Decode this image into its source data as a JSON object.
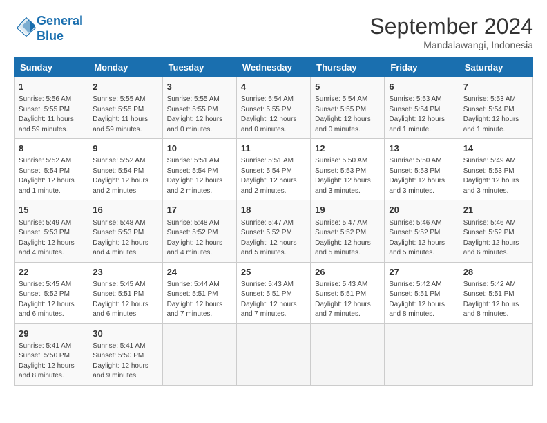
{
  "header": {
    "logo_line1": "General",
    "logo_line2": "Blue",
    "month": "September 2024",
    "location": "Mandalawangi, Indonesia"
  },
  "weekdays": [
    "Sunday",
    "Monday",
    "Tuesday",
    "Wednesday",
    "Thursday",
    "Friday",
    "Saturday"
  ],
  "weeks": [
    [
      {
        "day": "1",
        "info": "Sunrise: 5:56 AM\nSunset: 5:55 PM\nDaylight: 11 hours\nand 59 minutes."
      },
      {
        "day": "2",
        "info": "Sunrise: 5:55 AM\nSunset: 5:55 PM\nDaylight: 11 hours\nand 59 minutes."
      },
      {
        "day": "3",
        "info": "Sunrise: 5:55 AM\nSunset: 5:55 PM\nDaylight: 12 hours\nand 0 minutes."
      },
      {
        "day": "4",
        "info": "Sunrise: 5:54 AM\nSunset: 5:55 PM\nDaylight: 12 hours\nand 0 minutes."
      },
      {
        "day": "5",
        "info": "Sunrise: 5:54 AM\nSunset: 5:55 PM\nDaylight: 12 hours\nand 0 minutes."
      },
      {
        "day": "6",
        "info": "Sunrise: 5:53 AM\nSunset: 5:54 PM\nDaylight: 12 hours\nand 1 minute."
      },
      {
        "day": "7",
        "info": "Sunrise: 5:53 AM\nSunset: 5:54 PM\nDaylight: 12 hours\nand 1 minute."
      }
    ],
    [
      {
        "day": "8",
        "info": "Sunrise: 5:52 AM\nSunset: 5:54 PM\nDaylight: 12 hours\nand 1 minute."
      },
      {
        "day": "9",
        "info": "Sunrise: 5:52 AM\nSunset: 5:54 PM\nDaylight: 12 hours\nand 2 minutes."
      },
      {
        "day": "10",
        "info": "Sunrise: 5:51 AM\nSunset: 5:54 PM\nDaylight: 12 hours\nand 2 minutes."
      },
      {
        "day": "11",
        "info": "Sunrise: 5:51 AM\nSunset: 5:54 PM\nDaylight: 12 hours\nand 2 minutes."
      },
      {
        "day": "12",
        "info": "Sunrise: 5:50 AM\nSunset: 5:53 PM\nDaylight: 12 hours\nand 3 minutes."
      },
      {
        "day": "13",
        "info": "Sunrise: 5:50 AM\nSunset: 5:53 PM\nDaylight: 12 hours\nand 3 minutes."
      },
      {
        "day": "14",
        "info": "Sunrise: 5:49 AM\nSunset: 5:53 PM\nDaylight: 12 hours\nand 3 minutes."
      }
    ],
    [
      {
        "day": "15",
        "info": "Sunrise: 5:49 AM\nSunset: 5:53 PM\nDaylight: 12 hours\nand 4 minutes."
      },
      {
        "day": "16",
        "info": "Sunrise: 5:48 AM\nSunset: 5:53 PM\nDaylight: 12 hours\nand 4 minutes."
      },
      {
        "day": "17",
        "info": "Sunrise: 5:48 AM\nSunset: 5:52 PM\nDaylight: 12 hours\nand 4 minutes."
      },
      {
        "day": "18",
        "info": "Sunrise: 5:47 AM\nSunset: 5:52 PM\nDaylight: 12 hours\nand 5 minutes."
      },
      {
        "day": "19",
        "info": "Sunrise: 5:47 AM\nSunset: 5:52 PM\nDaylight: 12 hours\nand 5 minutes."
      },
      {
        "day": "20",
        "info": "Sunrise: 5:46 AM\nSunset: 5:52 PM\nDaylight: 12 hours\nand 5 minutes."
      },
      {
        "day": "21",
        "info": "Sunrise: 5:46 AM\nSunset: 5:52 PM\nDaylight: 12 hours\nand 6 minutes."
      }
    ],
    [
      {
        "day": "22",
        "info": "Sunrise: 5:45 AM\nSunset: 5:52 PM\nDaylight: 12 hours\nand 6 minutes."
      },
      {
        "day": "23",
        "info": "Sunrise: 5:45 AM\nSunset: 5:51 PM\nDaylight: 12 hours\nand 6 minutes."
      },
      {
        "day": "24",
        "info": "Sunrise: 5:44 AM\nSunset: 5:51 PM\nDaylight: 12 hours\nand 7 minutes."
      },
      {
        "day": "25",
        "info": "Sunrise: 5:43 AM\nSunset: 5:51 PM\nDaylight: 12 hours\nand 7 minutes."
      },
      {
        "day": "26",
        "info": "Sunrise: 5:43 AM\nSunset: 5:51 PM\nDaylight: 12 hours\nand 7 minutes."
      },
      {
        "day": "27",
        "info": "Sunrise: 5:42 AM\nSunset: 5:51 PM\nDaylight: 12 hours\nand 8 minutes."
      },
      {
        "day": "28",
        "info": "Sunrise: 5:42 AM\nSunset: 5:51 PM\nDaylight: 12 hours\nand 8 minutes."
      }
    ],
    [
      {
        "day": "29",
        "info": "Sunrise: 5:41 AM\nSunset: 5:50 PM\nDaylight: 12 hours\nand 8 minutes."
      },
      {
        "day": "30",
        "info": "Sunrise: 5:41 AM\nSunset: 5:50 PM\nDaylight: 12 hours\nand 9 minutes."
      },
      {
        "day": "",
        "info": ""
      },
      {
        "day": "",
        "info": ""
      },
      {
        "day": "",
        "info": ""
      },
      {
        "day": "",
        "info": ""
      },
      {
        "day": "",
        "info": ""
      }
    ]
  ]
}
